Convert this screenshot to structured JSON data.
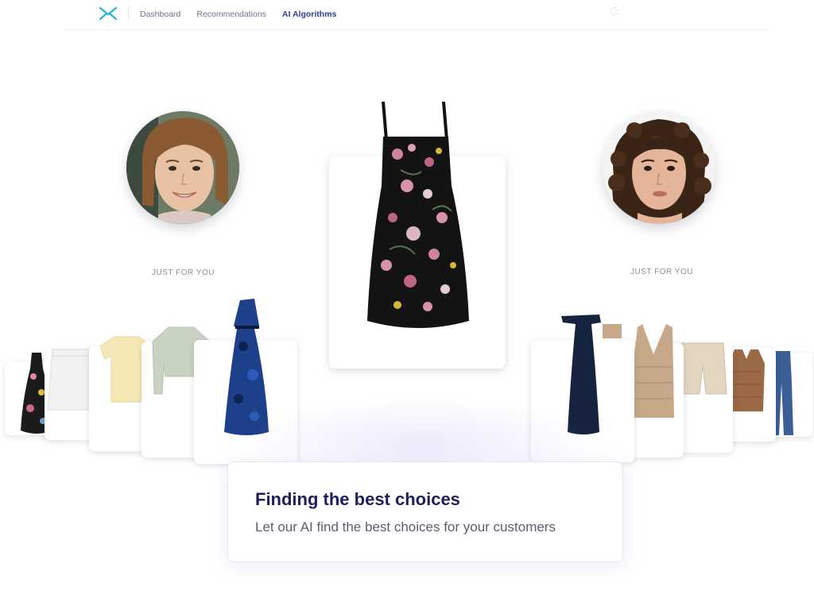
{
  "nav": {
    "items": [
      {
        "label": "Dashboard",
        "active": false
      },
      {
        "label": "Recommendations",
        "active": false
      },
      {
        "label": "AI Algorithms",
        "active": true
      }
    ],
    "accent": "#2a3f8f",
    "logo_color": "#1fb7d6"
  },
  "left_profile": {
    "section_label": "JUST FOR YOU"
  },
  "right_profile": {
    "section_label": "JUST FOR YOU"
  },
  "info": {
    "title": "Finding the best choices",
    "subtitle": "Let our AI find the best choices for your customers"
  },
  "products": {
    "featured": "floral-black-dress",
    "left_row": [
      "floral-mini-dress",
      "white-denim-skirt",
      "yellow-tshirt",
      "sage-sweater",
      "blue-satin-gown"
    ],
    "right_row": [
      "navy-off-shoulder-gown",
      "crochet-tank",
      "beige-shorts",
      "brown-knit-vest",
      "flared-jeans"
    ]
  }
}
